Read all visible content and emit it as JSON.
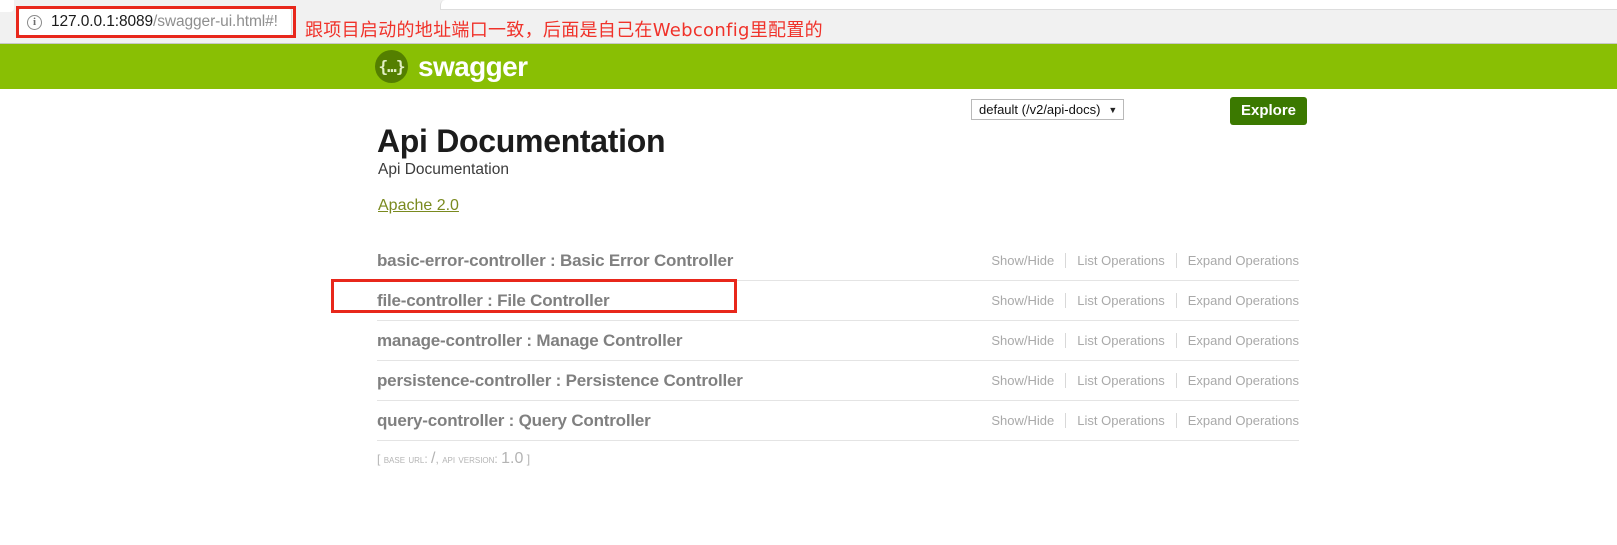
{
  "browser": {
    "info_icon": "info-icon",
    "url_host": "127.0.0.1:8089",
    "url_path": "/swagger-ui.html#!",
    "annotation": "跟项目启动的地址端口一致，后面是自己在Webconfig里配置的"
  },
  "header": {
    "logo_glyph": "{…}",
    "logo_text": "swagger",
    "api_select_value": "default (/v2/api-docs)",
    "api_select_caret": "▼",
    "explore_label": "Explore",
    "bar_color": "#89bf04",
    "explore_color": "#3b7900"
  },
  "main": {
    "title": "Api Documentation",
    "subtitle": "Api Documentation",
    "license_label": "Apache 2.0",
    "ops": {
      "show_hide": "Show/Hide",
      "list_operations": "List Operations",
      "expand_operations": "Expand Operations"
    },
    "resources": [
      {
        "name": "basic-error-controller : Basic Error Controller"
      },
      {
        "name": "file-controller : File Controller"
      },
      {
        "name": "manage-controller : Manage Controller"
      },
      {
        "name": "persistence-controller : Persistence Controller"
      },
      {
        "name": "query-controller : Query Controller"
      }
    ],
    "footer": {
      "open": "[",
      "base_url_label": "base url:",
      "base_url_value": "/",
      "comma": ",",
      "api_version_label": "api version:",
      "api_version_value": "1.0",
      "close": "]"
    }
  },
  "annotations": {
    "highlight_color": "#e8271b",
    "note_color": "#f0322a"
  }
}
